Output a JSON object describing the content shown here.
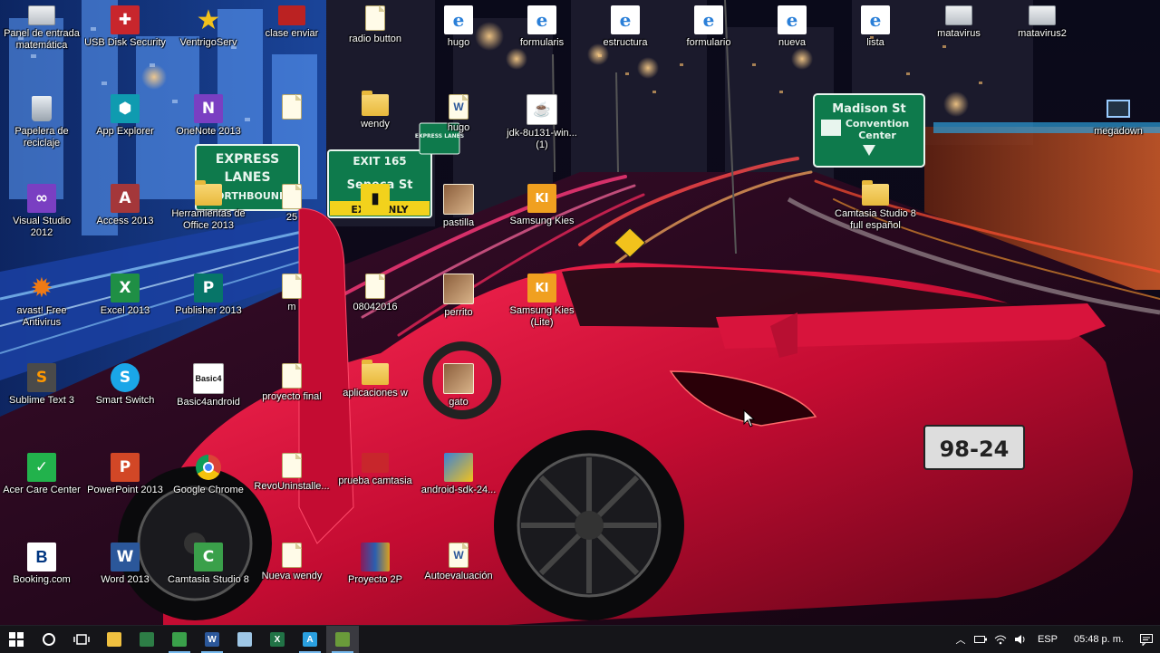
{
  "wallpaper": {
    "sign_express_line1": "EXPRESS",
    "sign_express_line2": "LANES",
    "sign_express_line3": "NORTHBOUND",
    "sign_exit_number": "EXIT 165",
    "sign_exit_street": "Seneca St",
    "sign_exit_only": "EXIT ONLY",
    "sign_madison_line1": "Madison St",
    "sign_madison_line2": "Convention",
    "sign_madison_line3": "Center",
    "plate": "98-24",
    "road_sign_small": "EXPRESS LANES"
  },
  "desktop": {
    "icons": [
      {
        "label": "Panel de entrada matemática",
        "glyph": "pen-tablet-icon"
      },
      {
        "label": "USB Disk Security",
        "glyph": "shield-icon"
      },
      {
        "label": "VentrigoServ",
        "glyph": "star-icon"
      },
      {
        "label": "clase enviar",
        "glyph": "video-file-icon"
      },
      {
        "label": "radio button",
        "glyph": "file-icon"
      },
      {
        "label": "hugo",
        "glyph": "ie-shortcut-icon"
      },
      {
        "label": "formularis",
        "glyph": "ie-shortcut-icon"
      },
      {
        "label": "estructura",
        "glyph": "ie-shortcut-icon"
      },
      {
        "label": "formulario",
        "glyph": "ie-shortcut-icon"
      },
      {
        "label": "nueva",
        "glyph": "ie-shortcut-icon"
      },
      {
        "label": "lista",
        "glyph": "ie-shortcut-icon"
      },
      {
        "label": "matavirus",
        "glyph": "gadget-icon"
      },
      {
        "label": "matavirus2",
        "glyph": "gadget-icon"
      },
      {
        "label": "Papelera de reciclaje",
        "glyph": "recycle-bin-icon"
      },
      {
        "label": "App Explorer",
        "glyph": "app-explorer-icon"
      },
      {
        "label": "OneNote 2013",
        "glyph": "onenote-icon"
      },
      {
        "label": "",
        "glyph": "file-icon"
      },
      {
        "label": "wendy",
        "glyph": "folder-icon"
      },
      {
        "label": "hugo",
        "glyph": "word-doc-icon"
      },
      {
        "label": "jdk-8u131-win...(1)",
        "glyph": "java-installer-icon"
      },
      {
        "label": "megadown",
        "glyph": "monitor-icon"
      },
      {
        "label": "Visual Studio 2012",
        "glyph": "visual-studio-icon"
      },
      {
        "label": "Access 2013",
        "glyph": "access-icon"
      },
      {
        "label": "Herramientas de Office 2013",
        "glyph": "office-tools-icon"
      },
      {
        "label": "25",
        "glyph": "file-icon"
      },
      {
        "label": "",
        "glyph": "book-icon"
      },
      {
        "label": "pastilla",
        "glyph": "image-icon"
      },
      {
        "label": "Samsung Kies",
        "glyph": "kies-icon"
      },
      {
        "label": "Camtasia Studio 8 full español",
        "glyph": "folder-icon"
      },
      {
        "label": "avast! Free Antivirus",
        "glyph": "avast-icon"
      },
      {
        "label": "Excel 2013",
        "glyph": "excel-icon"
      },
      {
        "label": "Publisher 2013",
        "glyph": "publisher-icon"
      },
      {
        "label": "m",
        "glyph": "file-icon"
      },
      {
        "label": "08042016",
        "glyph": "file-icon"
      },
      {
        "label": "perrito",
        "glyph": "image-icon"
      },
      {
        "label": "Samsung Kies (Lite)",
        "glyph": "kies-icon"
      },
      {
        "label": "Sublime Text 3",
        "glyph": "sublime-icon"
      },
      {
        "label": "Smart Switch",
        "glyph": "smart-switch-icon"
      },
      {
        "label": "Basic4android",
        "glyph": "basic4android-icon"
      },
      {
        "label": "proyecto final",
        "glyph": "file-icon"
      },
      {
        "label": "aplicaciones w",
        "glyph": "folder-icon"
      },
      {
        "label": "gato",
        "glyph": "image-icon"
      },
      {
        "label": "Acer Care Center",
        "glyph": "acer-care-icon"
      },
      {
        "label": "PowerPoint 2013",
        "glyph": "powerpoint-icon"
      },
      {
        "label": "Google Chrome",
        "glyph": "chrome-icon"
      },
      {
        "label": "RevoUninstalle...",
        "glyph": "file-icon"
      },
      {
        "label": "prueba camtasia",
        "glyph": "video-file-icon"
      },
      {
        "label": "android-sdk-24...",
        "glyph": "installer-icon"
      },
      {
        "label": "Booking.com",
        "glyph": "booking-icon"
      },
      {
        "label": "Word 2013",
        "glyph": "word-icon"
      },
      {
        "label": "Camtasia Studio 8",
        "glyph": "camtasia-icon"
      },
      {
        "label": "Nueva wendy",
        "glyph": "file-icon"
      },
      {
        "label": "Proyecto 2P",
        "glyph": "winrar-icon"
      },
      {
        "label": "Autoevaluación",
        "glyph": "word-doc-icon"
      }
    ]
  },
  "taskbar": {
    "start_icon": "windows-start-icon",
    "search_icon": "cortana-circle-icon",
    "task_view_icon": "task-view-icon",
    "apps": [
      {
        "name": "file-explorer",
        "glyph": "E",
        "color": "#f0c040"
      },
      {
        "name": "store",
        "glyph": "S",
        "color": "#2d7d46"
      },
      {
        "name": "camtasia",
        "glyph": "C",
        "color": "#3aa04a"
      },
      {
        "name": "word",
        "glyph": "W",
        "color": "#2b579a"
      },
      {
        "name": "notepad",
        "glyph": "N",
        "color": "#9fc7e6"
      },
      {
        "name": "excel",
        "glyph": "X",
        "color": "#217346"
      },
      {
        "name": "app",
        "glyph": "A",
        "color": "#2aa0e0"
      },
      {
        "name": "camtasia-recorder",
        "glyph": "R",
        "color": "#6a9b3a"
      }
    ],
    "tray": {
      "language": "ESP",
      "time": "05:48 p. m."
    }
  }
}
